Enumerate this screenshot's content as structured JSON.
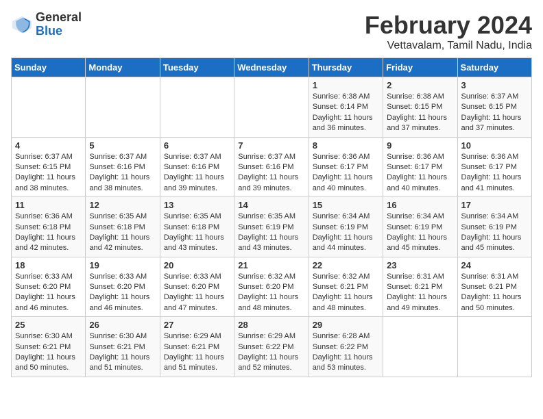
{
  "header": {
    "logo_general": "General",
    "logo_blue": "Blue",
    "title": "February 2024",
    "location": "Vettavalam, Tamil Nadu, India"
  },
  "days_of_week": [
    "Sunday",
    "Monday",
    "Tuesday",
    "Wednesday",
    "Thursday",
    "Friday",
    "Saturday"
  ],
  "weeks": [
    [
      {
        "day": "",
        "info": ""
      },
      {
        "day": "",
        "info": ""
      },
      {
        "day": "",
        "info": ""
      },
      {
        "day": "",
        "info": ""
      },
      {
        "day": "1",
        "info": "Sunrise: 6:38 AM\nSunset: 6:14 PM\nDaylight: 11 hours\nand 36 minutes."
      },
      {
        "day": "2",
        "info": "Sunrise: 6:38 AM\nSunset: 6:15 PM\nDaylight: 11 hours\nand 37 minutes."
      },
      {
        "day": "3",
        "info": "Sunrise: 6:37 AM\nSunset: 6:15 PM\nDaylight: 11 hours\nand 37 minutes."
      }
    ],
    [
      {
        "day": "4",
        "info": "Sunrise: 6:37 AM\nSunset: 6:15 PM\nDaylight: 11 hours\nand 38 minutes."
      },
      {
        "day": "5",
        "info": "Sunrise: 6:37 AM\nSunset: 6:16 PM\nDaylight: 11 hours\nand 38 minutes."
      },
      {
        "day": "6",
        "info": "Sunrise: 6:37 AM\nSunset: 6:16 PM\nDaylight: 11 hours\nand 39 minutes."
      },
      {
        "day": "7",
        "info": "Sunrise: 6:37 AM\nSunset: 6:16 PM\nDaylight: 11 hours\nand 39 minutes."
      },
      {
        "day": "8",
        "info": "Sunrise: 6:36 AM\nSunset: 6:17 PM\nDaylight: 11 hours\nand 40 minutes."
      },
      {
        "day": "9",
        "info": "Sunrise: 6:36 AM\nSunset: 6:17 PM\nDaylight: 11 hours\nand 40 minutes."
      },
      {
        "day": "10",
        "info": "Sunrise: 6:36 AM\nSunset: 6:17 PM\nDaylight: 11 hours\nand 41 minutes."
      }
    ],
    [
      {
        "day": "11",
        "info": "Sunrise: 6:36 AM\nSunset: 6:18 PM\nDaylight: 11 hours\nand 42 minutes."
      },
      {
        "day": "12",
        "info": "Sunrise: 6:35 AM\nSunset: 6:18 PM\nDaylight: 11 hours\nand 42 minutes."
      },
      {
        "day": "13",
        "info": "Sunrise: 6:35 AM\nSunset: 6:18 PM\nDaylight: 11 hours\nand 43 minutes."
      },
      {
        "day": "14",
        "info": "Sunrise: 6:35 AM\nSunset: 6:19 PM\nDaylight: 11 hours\nand 43 minutes."
      },
      {
        "day": "15",
        "info": "Sunrise: 6:34 AM\nSunset: 6:19 PM\nDaylight: 11 hours\nand 44 minutes."
      },
      {
        "day": "16",
        "info": "Sunrise: 6:34 AM\nSunset: 6:19 PM\nDaylight: 11 hours\nand 45 minutes."
      },
      {
        "day": "17",
        "info": "Sunrise: 6:34 AM\nSunset: 6:19 PM\nDaylight: 11 hours\nand 45 minutes."
      }
    ],
    [
      {
        "day": "18",
        "info": "Sunrise: 6:33 AM\nSunset: 6:20 PM\nDaylight: 11 hours\nand 46 minutes."
      },
      {
        "day": "19",
        "info": "Sunrise: 6:33 AM\nSunset: 6:20 PM\nDaylight: 11 hours\nand 46 minutes."
      },
      {
        "day": "20",
        "info": "Sunrise: 6:33 AM\nSunset: 6:20 PM\nDaylight: 11 hours\nand 47 minutes."
      },
      {
        "day": "21",
        "info": "Sunrise: 6:32 AM\nSunset: 6:20 PM\nDaylight: 11 hours\nand 48 minutes."
      },
      {
        "day": "22",
        "info": "Sunrise: 6:32 AM\nSunset: 6:21 PM\nDaylight: 11 hours\nand 48 minutes."
      },
      {
        "day": "23",
        "info": "Sunrise: 6:31 AM\nSunset: 6:21 PM\nDaylight: 11 hours\nand 49 minutes."
      },
      {
        "day": "24",
        "info": "Sunrise: 6:31 AM\nSunset: 6:21 PM\nDaylight: 11 hours\nand 50 minutes."
      }
    ],
    [
      {
        "day": "25",
        "info": "Sunrise: 6:30 AM\nSunset: 6:21 PM\nDaylight: 11 hours\nand 50 minutes."
      },
      {
        "day": "26",
        "info": "Sunrise: 6:30 AM\nSunset: 6:21 PM\nDaylight: 11 hours\nand 51 minutes."
      },
      {
        "day": "27",
        "info": "Sunrise: 6:29 AM\nSunset: 6:21 PM\nDaylight: 11 hours\nand 51 minutes."
      },
      {
        "day": "28",
        "info": "Sunrise: 6:29 AM\nSunset: 6:22 PM\nDaylight: 11 hours\nand 52 minutes."
      },
      {
        "day": "29",
        "info": "Sunrise: 6:28 AM\nSunset: 6:22 PM\nDaylight: 11 hours\nand 53 minutes."
      },
      {
        "day": "",
        "info": ""
      },
      {
        "day": "",
        "info": ""
      }
    ]
  ]
}
